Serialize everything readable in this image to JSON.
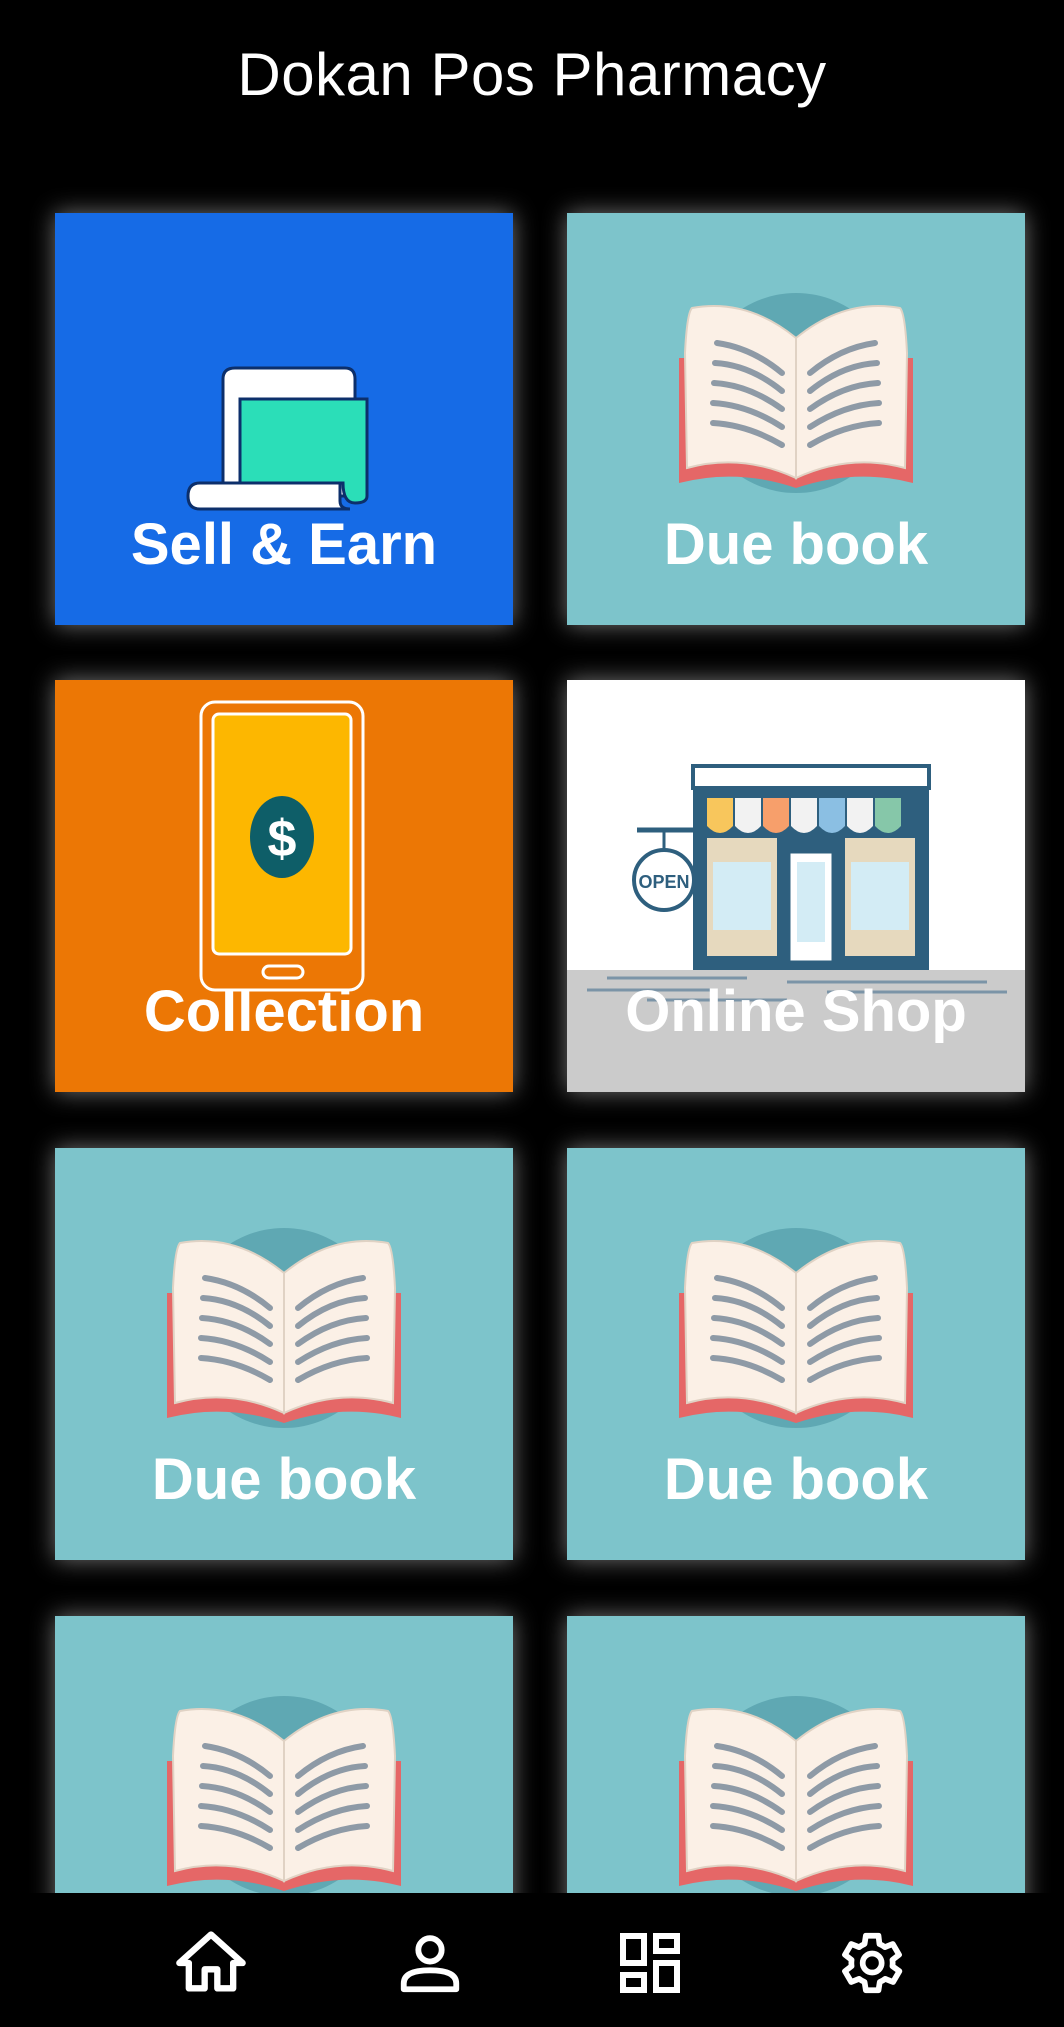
{
  "app": {
    "title": "Dokan Pos Pharmacy"
  },
  "colors": {
    "background": "#000000",
    "sell_tile": "#166BE6",
    "due_tile": "#7DC4CB",
    "collection_tile": "#EC7705",
    "shop_tile": "#FFFFFF"
  },
  "tiles": [
    {
      "label": "Sell & Earn",
      "icon": "receipt-icon"
    },
    {
      "label": "Due book",
      "icon": "open-book-icon"
    },
    {
      "label": "Collection",
      "icon": "phone-dollar-icon"
    },
    {
      "label": "Online Shop",
      "icon": "storefront-icon"
    },
    {
      "label": "Due book",
      "icon": "open-book-icon"
    },
    {
      "label": "Due book",
      "icon": "open-book-icon"
    },
    {
      "label": "",
      "icon": "open-book-icon"
    },
    {
      "label": "",
      "icon": "open-book-icon"
    }
  ],
  "nav": [
    {
      "icon": "home-icon"
    },
    {
      "icon": "person-icon"
    },
    {
      "icon": "dashboard-icon"
    },
    {
      "icon": "gear-icon"
    }
  ],
  "shop_sign": "OPEN"
}
